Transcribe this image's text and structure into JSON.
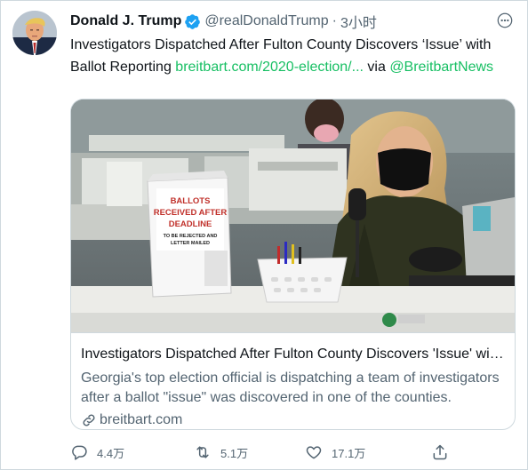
{
  "tweet": {
    "author_name": "Donald J. Trump",
    "handle": "@realDonaldTrump",
    "separator": "·",
    "time": "3小时",
    "text_prefix": "Investigators Dispatched After Fulton County Discovers ‘Issue’ with Ballot Reporting ",
    "link_text": "breitbart.com/2020-election/...",
    "text_via": " via ",
    "mention": "@BreitbartNews"
  },
  "card": {
    "sign_line1": "BALLOTS",
    "sign_line2": "RECEIVED AFTER",
    "sign_line3": "DEADLINE",
    "sign_line4": "TO BE REJECTED AND",
    "sign_line5": "LETTER MAILED",
    "title": "Investigators Dispatched After Fulton County Discovers 'Issue' with Ballot Reporting",
    "description": "Georgia's top election official is dispatching a team of investigators after a ballot \"issue\" was discovered in one of the counties.",
    "domain": "breitbart.com"
  },
  "actions": {
    "reply_count": "4.4万",
    "retweet_count": "5.1万",
    "like_count": "17.1万"
  },
  "colors": {
    "link": "#17bf63",
    "verified": "#1da1f2",
    "muted_text": "#536471",
    "border": "#cfd9de"
  },
  "icons": [
    "verified-badge-icon",
    "more-options-icon",
    "link-icon",
    "reply-icon",
    "retweet-icon",
    "like-icon",
    "share-icon"
  ]
}
